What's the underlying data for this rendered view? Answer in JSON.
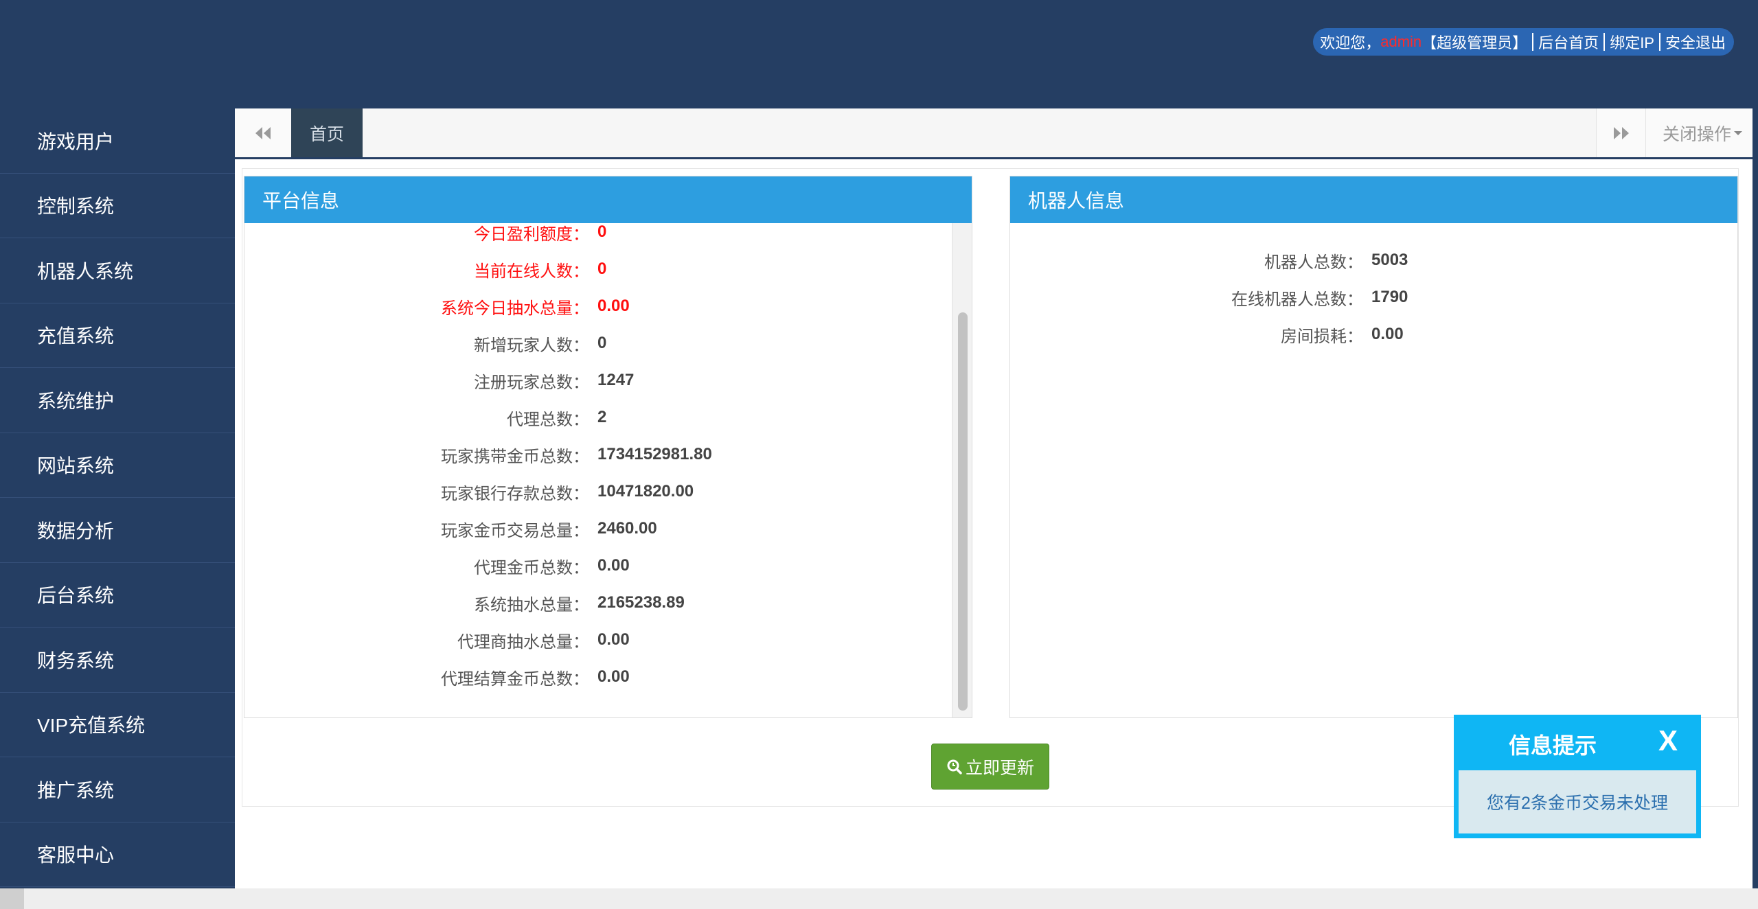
{
  "header": {
    "welcome_prefix": "欢迎您，",
    "username": "admin",
    "role": "【超级管理员】",
    "links": [
      "后台首页",
      "绑定IP",
      "安全退出"
    ]
  },
  "sidebar": {
    "items": [
      {
        "label": "游戏用户"
      },
      {
        "label": "控制系统"
      },
      {
        "label": "机器人系统"
      },
      {
        "label": "充值系统"
      },
      {
        "label": "系统维护"
      },
      {
        "label": "网站系统"
      },
      {
        "label": "数据分析"
      },
      {
        "label": "后台系统"
      },
      {
        "label": "财务系统"
      },
      {
        "label": "VIP充值系统"
      },
      {
        "label": "推广系统"
      },
      {
        "label": "客服中心"
      }
    ]
  },
  "tabs": {
    "home": "首页",
    "close_ops": "关闭操作"
  },
  "platform": {
    "title": "平台信息",
    "rows": [
      {
        "label": "今日盈利额度：",
        "value": "0",
        "highlight": true
      },
      {
        "label": "当前在线人数：",
        "value": "0",
        "highlight": true
      },
      {
        "label": "系统今日抽水总量：",
        "value": "0.00",
        "highlight": true
      },
      {
        "label": "新增玩家人数：",
        "value": "0",
        "highlight": false
      },
      {
        "label": "注册玩家总数：",
        "value": "1247",
        "highlight": false
      },
      {
        "label": "代理总数：",
        "value": "2",
        "highlight": false
      },
      {
        "label": "玩家携带金币总数：",
        "value": "1734152981.80",
        "highlight": false
      },
      {
        "label": "玩家银行存款总数：",
        "value": "10471820.00",
        "highlight": false
      },
      {
        "label": "玩家金币交易总量：",
        "value": "2460.00",
        "highlight": false
      },
      {
        "label": "代理金币总数：",
        "value": "0.00",
        "highlight": false
      },
      {
        "label": "系统抽水总量：",
        "value": "2165238.89",
        "highlight": false
      },
      {
        "label": "代理商抽水总量：",
        "value": "0.00",
        "highlight": false
      },
      {
        "label": "代理结算金币总数：",
        "value": "0.00",
        "highlight": false
      }
    ]
  },
  "robot": {
    "title": "机器人信息",
    "rows": [
      {
        "label": "机器人总数：",
        "value": "5003"
      },
      {
        "label": "在线机器人总数：",
        "value": "1790"
      },
      {
        "label": "房间损耗：",
        "value": "0.00"
      }
    ]
  },
  "update_button": {
    "label": "立即更新"
  },
  "notification": {
    "title": "信息提示",
    "close": "X",
    "message": "您有2条金币交易未处理"
  },
  "colors": {
    "nav_bg": "#253e63",
    "panel_header": "#2d9ee0",
    "highlight": "#ff1010",
    "button": "#5fa332",
    "notify": "#0fb6f4"
  }
}
